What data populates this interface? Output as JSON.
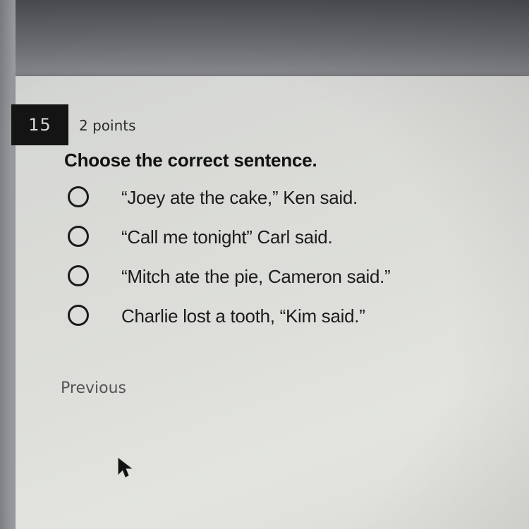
{
  "question": {
    "number": "15",
    "points": "2 points",
    "prompt": "Choose the correct sentence.",
    "options": [
      {
        "label": "“Joey ate the cake,” Ken said.",
        "selected": false
      },
      {
        "label": "“Call me tonight” Carl said.",
        "selected": false
      },
      {
        "label": "“Mitch ate the pie, Cameron said.”",
        "selected": false
      },
      {
        "label": "Charlie lost a tooth, “Kim said.”",
        "selected": false
      }
    ]
  },
  "nav": {
    "previous_label": "Previous"
  },
  "icons": {
    "radio": "radio-unchecked-icon",
    "cursor": "mouse-pointer-icon"
  }
}
